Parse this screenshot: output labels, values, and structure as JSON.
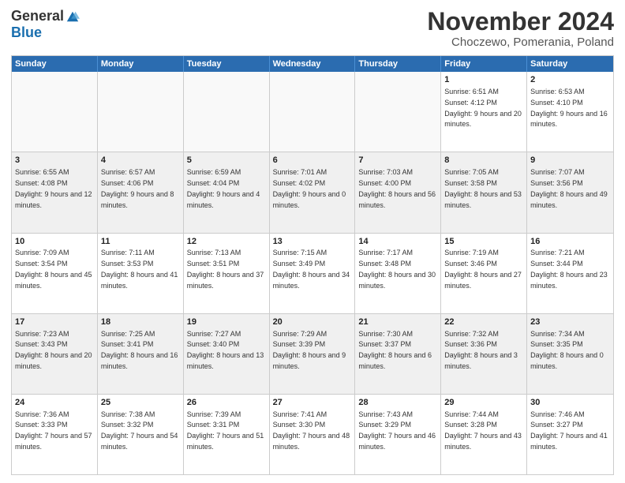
{
  "logo": {
    "general": "General",
    "blue": "Blue"
  },
  "header": {
    "month": "November 2024",
    "location": "Choczewo, Pomerania, Poland"
  },
  "days": [
    "Sunday",
    "Monday",
    "Tuesday",
    "Wednesday",
    "Thursday",
    "Friday",
    "Saturday"
  ],
  "weeks": [
    [
      {
        "day": "",
        "sunrise": "",
        "sunset": "",
        "daylight": "",
        "empty": true
      },
      {
        "day": "",
        "sunrise": "",
        "sunset": "",
        "daylight": "",
        "empty": true
      },
      {
        "day": "",
        "sunrise": "",
        "sunset": "",
        "daylight": "",
        "empty": true
      },
      {
        "day": "",
        "sunrise": "",
        "sunset": "",
        "daylight": "",
        "empty": true
      },
      {
        "day": "",
        "sunrise": "",
        "sunset": "",
        "daylight": "",
        "empty": true
      },
      {
        "day": "1",
        "sunrise": "Sunrise: 6:51 AM",
        "sunset": "Sunset: 4:12 PM",
        "daylight": "Daylight: 9 hours and 20 minutes.",
        "empty": false
      },
      {
        "day": "2",
        "sunrise": "Sunrise: 6:53 AM",
        "sunset": "Sunset: 4:10 PM",
        "daylight": "Daylight: 9 hours and 16 minutes.",
        "empty": false
      }
    ],
    [
      {
        "day": "3",
        "sunrise": "Sunrise: 6:55 AM",
        "sunset": "Sunset: 4:08 PM",
        "daylight": "Daylight: 9 hours and 12 minutes.",
        "empty": false
      },
      {
        "day": "4",
        "sunrise": "Sunrise: 6:57 AM",
        "sunset": "Sunset: 4:06 PM",
        "daylight": "Daylight: 9 hours and 8 minutes.",
        "empty": false
      },
      {
        "day": "5",
        "sunrise": "Sunrise: 6:59 AM",
        "sunset": "Sunset: 4:04 PM",
        "daylight": "Daylight: 9 hours and 4 minutes.",
        "empty": false
      },
      {
        "day": "6",
        "sunrise": "Sunrise: 7:01 AM",
        "sunset": "Sunset: 4:02 PM",
        "daylight": "Daylight: 9 hours and 0 minutes.",
        "empty": false
      },
      {
        "day": "7",
        "sunrise": "Sunrise: 7:03 AM",
        "sunset": "Sunset: 4:00 PM",
        "daylight": "Daylight: 8 hours and 56 minutes.",
        "empty": false
      },
      {
        "day": "8",
        "sunrise": "Sunrise: 7:05 AM",
        "sunset": "Sunset: 3:58 PM",
        "daylight": "Daylight: 8 hours and 53 minutes.",
        "empty": false
      },
      {
        "day": "9",
        "sunrise": "Sunrise: 7:07 AM",
        "sunset": "Sunset: 3:56 PM",
        "daylight": "Daylight: 8 hours and 49 minutes.",
        "empty": false
      }
    ],
    [
      {
        "day": "10",
        "sunrise": "Sunrise: 7:09 AM",
        "sunset": "Sunset: 3:54 PM",
        "daylight": "Daylight: 8 hours and 45 minutes.",
        "empty": false
      },
      {
        "day": "11",
        "sunrise": "Sunrise: 7:11 AM",
        "sunset": "Sunset: 3:53 PM",
        "daylight": "Daylight: 8 hours and 41 minutes.",
        "empty": false
      },
      {
        "day": "12",
        "sunrise": "Sunrise: 7:13 AM",
        "sunset": "Sunset: 3:51 PM",
        "daylight": "Daylight: 8 hours and 37 minutes.",
        "empty": false
      },
      {
        "day": "13",
        "sunrise": "Sunrise: 7:15 AM",
        "sunset": "Sunset: 3:49 PM",
        "daylight": "Daylight: 8 hours and 34 minutes.",
        "empty": false
      },
      {
        "day": "14",
        "sunrise": "Sunrise: 7:17 AM",
        "sunset": "Sunset: 3:48 PM",
        "daylight": "Daylight: 8 hours and 30 minutes.",
        "empty": false
      },
      {
        "day": "15",
        "sunrise": "Sunrise: 7:19 AM",
        "sunset": "Sunset: 3:46 PM",
        "daylight": "Daylight: 8 hours and 27 minutes.",
        "empty": false
      },
      {
        "day": "16",
        "sunrise": "Sunrise: 7:21 AM",
        "sunset": "Sunset: 3:44 PM",
        "daylight": "Daylight: 8 hours and 23 minutes.",
        "empty": false
      }
    ],
    [
      {
        "day": "17",
        "sunrise": "Sunrise: 7:23 AM",
        "sunset": "Sunset: 3:43 PM",
        "daylight": "Daylight: 8 hours and 20 minutes.",
        "empty": false
      },
      {
        "day": "18",
        "sunrise": "Sunrise: 7:25 AM",
        "sunset": "Sunset: 3:41 PM",
        "daylight": "Daylight: 8 hours and 16 minutes.",
        "empty": false
      },
      {
        "day": "19",
        "sunrise": "Sunrise: 7:27 AM",
        "sunset": "Sunset: 3:40 PM",
        "daylight": "Daylight: 8 hours and 13 minutes.",
        "empty": false
      },
      {
        "day": "20",
        "sunrise": "Sunrise: 7:29 AM",
        "sunset": "Sunset: 3:39 PM",
        "daylight": "Daylight: 8 hours and 9 minutes.",
        "empty": false
      },
      {
        "day": "21",
        "sunrise": "Sunrise: 7:30 AM",
        "sunset": "Sunset: 3:37 PM",
        "daylight": "Daylight: 8 hours and 6 minutes.",
        "empty": false
      },
      {
        "day": "22",
        "sunrise": "Sunrise: 7:32 AM",
        "sunset": "Sunset: 3:36 PM",
        "daylight": "Daylight: 8 hours and 3 minutes.",
        "empty": false
      },
      {
        "day": "23",
        "sunrise": "Sunrise: 7:34 AM",
        "sunset": "Sunset: 3:35 PM",
        "daylight": "Daylight: 8 hours and 0 minutes.",
        "empty": false
      }
    ],
    [
      {
        "day": "24",
        "sunrise": "Sunrise: 7:36 AM",
        "sunset": "Sunset: 3:33 PM",
        "daylight": "Daylight: 7 hours and 57 minutes.",
        "empty": false
      },
      {
        "day": "25",
        "sunrise": "Sunrise: 7:38 AM",
        "sunset": "Sunset: 3:32 PM",
        "daylight": "Daylight: 7 hours and 54 minutes.",
        "empty": false
      },
      {
        "day": "26",
        "sunrise": "Sunrise: 7:39 AM",
        "sunset": "Sunset: 3:31 PM",
        "daylight": "Daylight: 7 hours and 51 minutes.",
        "empty": false
      },
      {
        "day": "27",
        "sunrise": "Sunrise: 7:41 AM",
        "sunset": "Sunset: 3:30 PM",
        "daylight": "Daylight: 7 hours and 48 minutes.",
        "empty": false
      },
      {
        "day": "28",
        "sunrise": "Sunrise: 7:43 AM",
        "sunset": "Sunset: 3:29 PM",
        "daylight": "Daylight: 7 hours and 46 minutes.",
        "empty": false
      },
      {
        "day": "29",
        "sunrise": "Sunrise: 7:44 AM",
        "sunset": "Sunset: 3:28 PM",
        "daylight": "Daylight: 7 hours and 43 minutes.",
        "empty": false
      },
      {
        "day": "30",
        "sunrise": "Sunrise: 7:46 AM",
        "sunset": "Sunset: 3:27 PM",
        "daylight": "Daylight: 7 hours and 41 minutes.",
        "empty": false
      }
    ]
  ]
}
